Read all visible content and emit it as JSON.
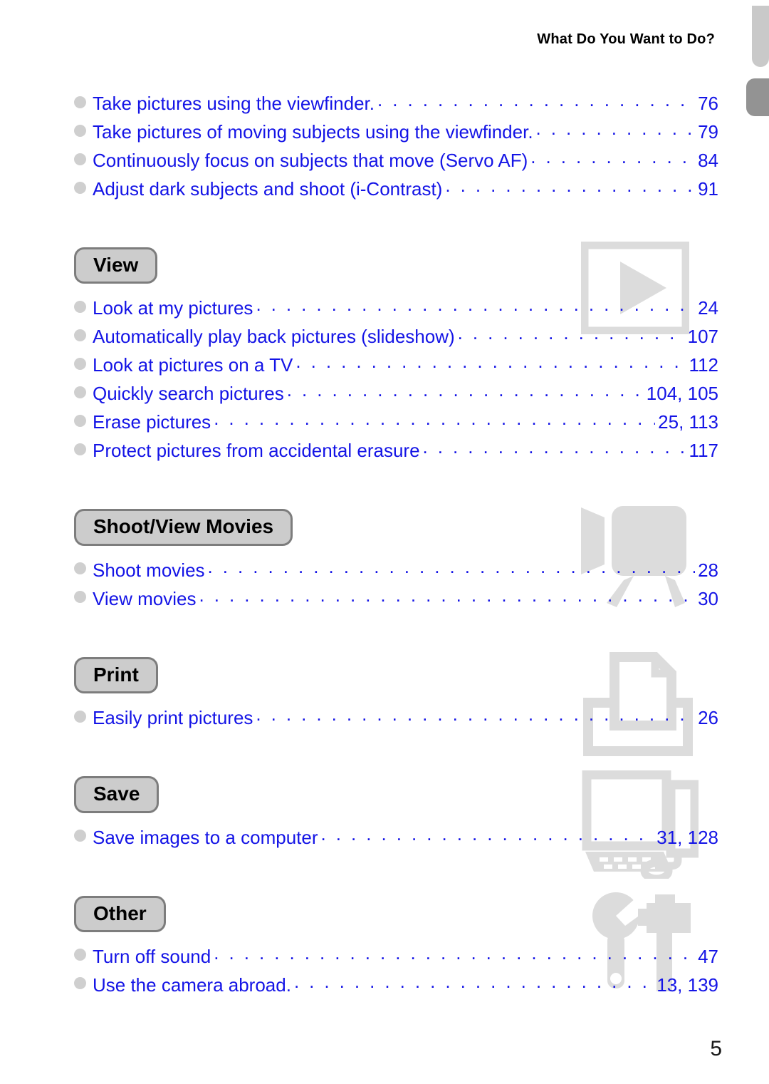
{
  "header": {
    "running_title": "What Do You Want to Do?"
  },
  "page_number": "5",
  "colors": {
    "link_blue": "#1414e6",
    "bullet_gray": "#cfcfcf",
    "pill_fill": "#cccccc",
    "pill_border": "#7d7d7d",
    "watermark_gray": "#dcdcdc",
    "tab_light": "#c9c9c9",
    "tab_dark": "#939393"
  },
  "intro_entries": [
    {
      "label": "Take pictures using the viewfinder.",
      "page": "76"
    },
    {
      "label": "Take pictures of moving subjects using the viewfinder.",
      "page": "79"
    },
    {
      "label": "Continuously focus on subjects that move (Servo AF)",
      "page": "84"
    },
    {
      "label": "Adjust dark subjects and shoot (i-Contrast)",
      "page": "91"
    }
  ],
  "sections": [
    {
      "title": "View",
      "icon": "play-frame-icon",
      "entries": [
        {
          "label": "Look at my pictures",
          "page": "24"
        },
        {
          "label": "Automatically play back pictures (slideshow)",
          "page": "107"
        },
        {
          "label": "Look at pictures on a TV",
          "page": "112"
        },
        {
          "label": "Quickly search pictures",
          "page": "104, 105"
        },
        {
          "label": "Erase pictures",
          "page": "25, 113"
        },
        {
          "label": "Protect pictures from accidental erasure",
          "page": "117"
        }
      ]
    },
    {
      "title": "Shoot/View Movies",
      "icon": "movie-camera-icon",
      "entries": [
        {
          "label": "Shoot movies",
          "page": "28"
        },
        {
          "label": "View movies",
          "page": "30"
        }
      ]
    },
    {
      "title": "Print",
      "icon": "printer-icon",
      "entries": [
        {
          "label": "Easily print pictures",
          "page": "26"
        }
      ]
    },
    {
      "title": "Save",
      "icon": "computer-icon",
      "entries": [
        {
          "label": "Save images to a computer",
          "page": "31, 128"
        }
      ]
    },
    {
      "title": "Other",
      "icon": "wrench-hammer-icon",
      "entries": [
        {
          "label": "Turn off sound",
          "page": "47"
        },
        {
          "label": "Use the camera abroad.",
          "page": "13, 139"
        }
      ]
    }
  ]
}
